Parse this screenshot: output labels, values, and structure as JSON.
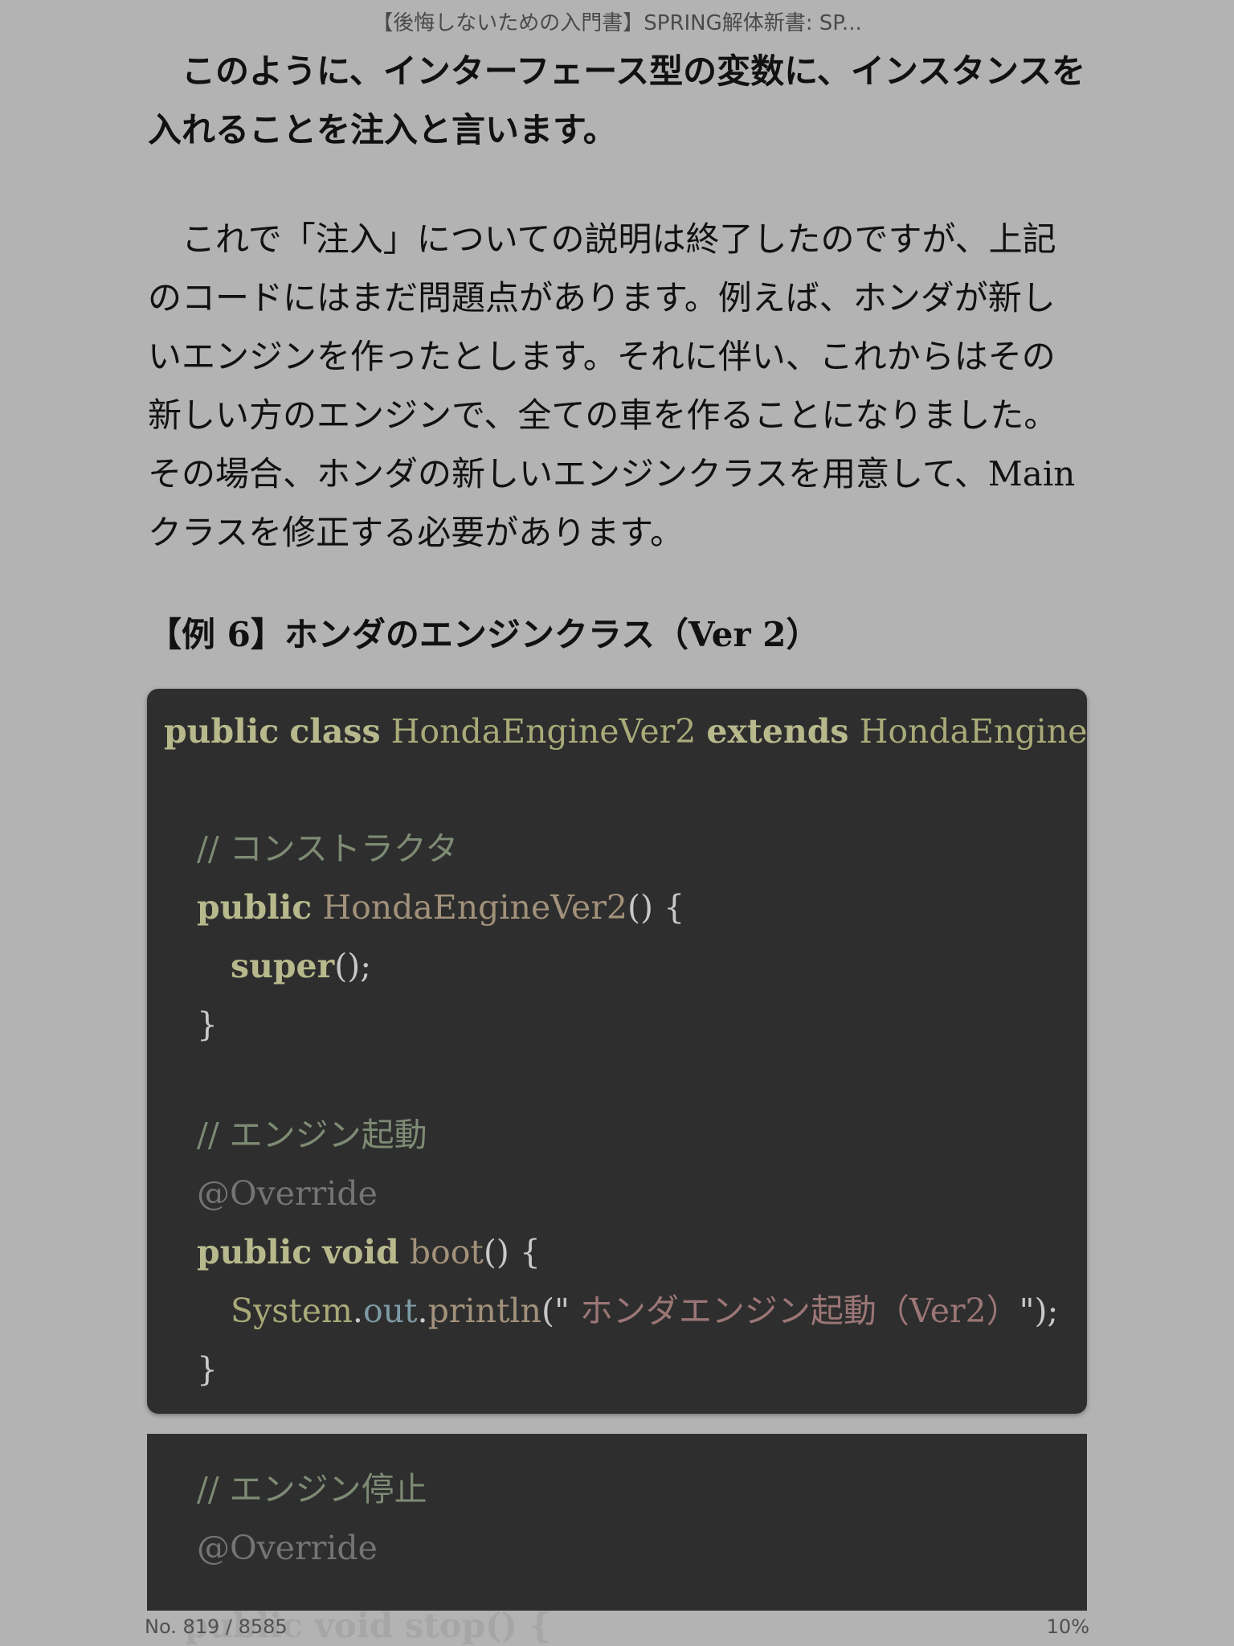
{
  "header": {
    "book_title": "【後悔しないための入門書】SPRING解体新書: SP..."
  },
  "body": {
    "para1": "このように、インターフェース型の変数に、インスタンスを入れることを注入と言います。",
    "para2": "これで「注入」についての説明は終了したのですが、上記のコードにはまだ問題点があります。例えば、ホンダが新しいエンジンを作ったとします。それに伴い、これからはその新しい方のエンジンで、全ての車を作ることになりました。その場合、ホンダの新しいエンジンクラスを用意して、Main クラスを修正する必要があります。",
    "example_heading": "【例 6】ホンダのエンジンクラス（Ver 2）"
  },
  "code": {
    "public": "public",
    "class": "class",
    "extends": "extends",
    "void": "void",
    "super": "super",
    "class_name": "HondaEngineVer2",
    "parent_class": "HondaEngine",
    "comment_constructor": "// コンストラクタ",
    "comment_boot": "// エンジン起動",
    "comment_stop": "// エンジン停止",
    "override": "@Override",
    "boot_method": "boot",
    "system": "System",
    "out": "out",
    "println": "println",
    "println_string": " ホンダエンジン起動（Ver2）",
    "brace_open": "{",
    "brace_close": "}",
    "parens": "()",
    "parens_open": "(\"",
    "parens_close": "\");",
    "super_call_end": "();",
    "dot": ".",
    "faded_line": "public void stop() {"
  },
  "footer": {
    "location": "No. 819 / 8585",
    "percent": "10%"
  }
}
